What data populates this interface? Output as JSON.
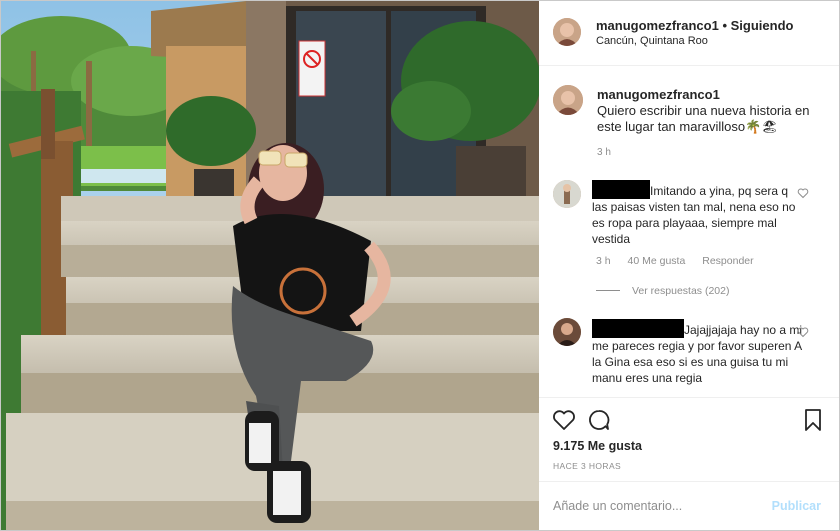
{
  "post": {
    "username": "manugomezfranco1",
    "separator": "•",
    "follow_label": "Siguiendo",
    "location": "Cancún, Quintana Roo"
  },
  "photo": {
    "sign_icon": "no-entry-sign-icon"
  },
  "caption": {
    "username": "manugomezfranco1",
    "text": "Quiero escribir una nueva historia en este lugar tan maravilloso🌴🏖",
    "time": "3 h"
  },
  "comments": [
    {
      "text": "Imitando a yina, pq sera q las paisas visten tan mal, nena eso no es ropa para playaaa, siempre mal vestida",
      "time": "3 h",
      "likes": "40 Me gusta",
      "reply_label": "Responder",
      "view_replies": "Ver respuestas (202)"
    },
    {
      "text": "Jajajjajaja hay no a mi me pareces regia y por favor superen A la Gina esa eso si es una guisa tu mi manu eres una regia"
    }
  ],
  "actions": {
    "like_icon": "heart-icon",
    "comment_icon": "comment-bubble-icon",
    "save_icon": "bookmark-icon",
    "likes": "9.175 Me gusta",
    "posted": "HACE 3 HORAS"
  },
  "add_comment": {
    "placeholder": "Añade un comentario...",
    "publish_label": "Publicar"
  },
  "colors": {
    "link_disabled": "#b2dffc",
    "muted": "#8e8e8e",
    "text": "#262626"
  }
}
